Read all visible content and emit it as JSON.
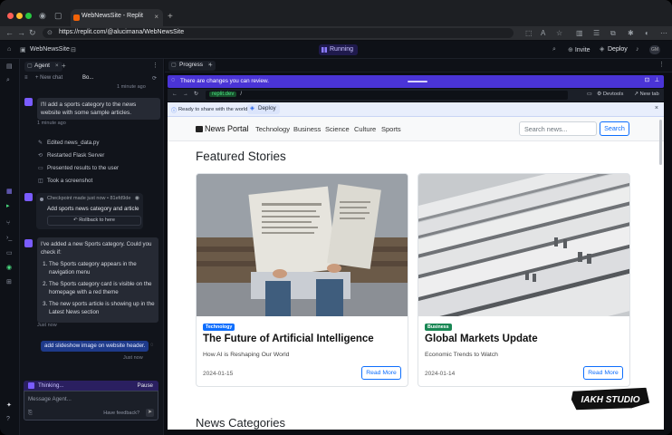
{
  "browser": {
    "tab_title": "WebNewsSite - Replit",
    "url": "https://replit.com/@alucimana/WebNewsSite"
  },
  "replit": {
    "project_name": "WebNewsSite",
    "run_status": "Running",
    "invite_label": "Invite",
    "deploy_label": "Deploy",
    "avatar_label": "GM"
  },
  "agent": {
    "tab_label": "Agent",
    "new_chat": "New chat",
    "branch": "Bo...",
    "time_top": "1 minute ago",
    "msg1": "I'll add a sports category to the news website with some sample articles.",
    "msg1_time": "1 minute ago",
    "actions": [
      {
        "icon": "edit-icon",
        "text": "Edited news_data.py"
      },
      {
        "icon": "restart-icon",
        "text": "Restarted Flask Server"
      },
      {
        "icon": "present-icon",
        "text": "Presented results to the user"
      },
      {
        "icon": "camera-icon",
        "text": "Took a screenshot"
      }
    ],
    "checkpoint_header": "Checkpoint made just now • 81efd9de",
    "checkpoint_body": "Add sports news category and article",
    "rollback": "Rollback to here",
    "msg2_intro": "I've added a new Sports category. Could you check if:",
    "msg2_items": [
      "The Sports category appears in the navigation menu",
      "The Sports category card is visible on the homepage with a red theme",
      "The new sports article is showing up in the Latest News section"
    ],
    "msg2_time": "Just now",
    "user_msg": "add slideshow image on website header.",
    "user_time": "Just now",
    "thinking": "Thinking...",
    "pause": "Pause",
    "input_placeholder": "Message Agent...",
    "feedback": "Have feedback?"
  },
  "preview": {
    "tab_label": "Progress",
    "notice": "There are changes you can review.",
    "url_host": "replit.dev",
    "url_path": "/",
    "devtools": "Devtools",
    "new_tab": "New tab",
    "share_text": "Ready to share with the world?",
    "share_deploy": "Deploy"
  },
  "site": {
    "brand": "News Portal",
    "nav": [
      "Technology",
      "Business",
      "Science",
      "Culture",
      "Sports"
    ],
    "search_placeholder": "Search news...",
    "search_button": "Search",
    "featured_heading": "Featured Stories",
    "cards": [
      {
        "badge": "Technology",
        "badge_color": "#0d6efd",
        "title": "The Future of Artificial Intelligence",
        "subtitle": "How AI is Reshaping Our World",
        "date": "2024-01-15",
        "button": "Read More"
      },
      {
        "badge": "Business",
        "badge_color": "#198754",
        "title": "Global Markets Update",
        "subtitle": "Economic Trends to Watch",
        "date": "2024-01-14",
        "button": "Read More"
      }
    ],
    "categories_heading": "News Categories"
  },
  "watermark": "IAKH STUDIO",
  "colors": {
    "accent": "#0d6efd",
    "replit_purple": "#4a34d6"
  }
}
